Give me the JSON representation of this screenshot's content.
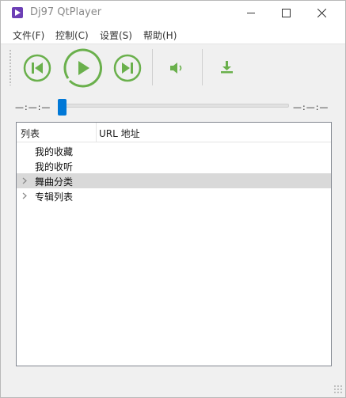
{
  "window": {
    "title": "Dj97 QtPlayer"
  },
  "menubar": {
    "items": [
      {
        "label": "文件(F)"
      },
      {
        "label": "控制(C)"
      },
      {
        "label": "设置(S)"
      },
      {
        "label": "帮助(H)"
      }
    ]
  },
  "toolbar": {
    "accent_color": "#6ab04c",
    "buttons": [
      "previous",
      "play",
      "next",
      "volume",
      "download"
    ]
  },
  "seek": {
    "elapsed": "—:—:—",
    "total": "—:—:—",
    "position": 0.0
  },
  "tree": {
    "columns": [
      "列表",
      "URL 地址"
    ],
    "rows": [
      {
        "label": "我的收藏",
        "expandable": false,
        "selected": false
      },
      {
        "label": "我的收听",
        "expandable": false,
        "selected": false
      },
      {
        "label": "舞曲分类",
        "expandable": true,
        "selected": true
      },
      {
        "label": "专辑列表",
        "expandable": true,
        "selected": false
      }
    ]
  }
}
